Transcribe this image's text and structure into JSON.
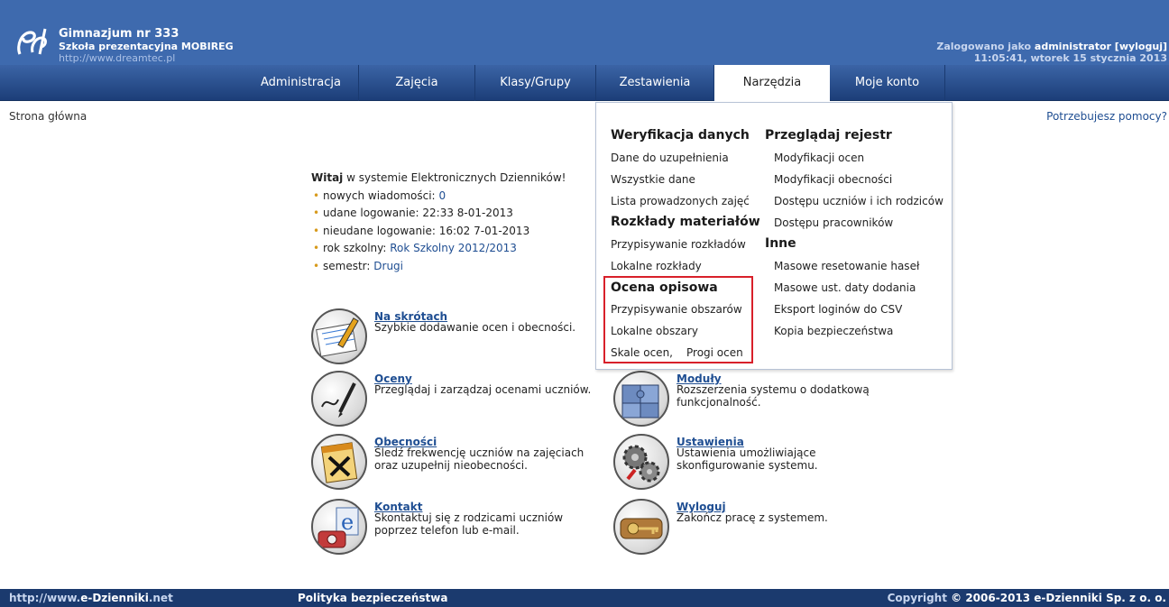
{
  "header": {
    "school_name": "Gimnazjum nr 333",
    "school_subtitle": "Szkoła prezentacyjna MOBIREG",
    "school_url": "http://www.dreamtec.pl",
    "logged_as_prefix": "Zalogowano jako",
    "user": "administrator",
    "logout": "[wyloguj]",
    "datetime": "11:05:41, wtorek 15 stycznia 2013"
  },
  "nav": {
    "tabs": [
      "Administracja",
      "Zajęcia",
      "Klasy/Grupy",
      "Zestawienia",
      "Narzędzia",
      "Moje konto"
    ],
    "active": "Narzędzia"
  },
  "breadcrumb": "Strona główna",
  "help_link": "Potrzebujesz pomocy?",
  "welcome": {
    "title_bold": "Witaj",
    "title_rest": " w systemie Elektronicznych Dzienników!",
    "items": [
      {
        "label": "nowych wiadomości:",
        "value": "0"
      },
      {
        "label": "udane logowanie:",
        "value": "22:33 8-01-2013"
      },
      {
        "label": "nieudane logowanie:",
        "value": "16:02 7-01-2013"
      },
      {
        "label": "rok szkolny:",
        "value": "Rok Szkolny 2012/2013"
      },
      {
        "label": "semestr:",
        "value": "Drugi"
      }
    ]
  },
  "shortcuts": [
    {
      "title": "Na skrótach",
      "desc": "Szybkie dodawanie ocen i obecności."
    },
    {
      "title": "Oceny",
      "desc": "Przeglądaj i zarządzaj ocenami uczniów."
    },
    {
      "title": "Obecności",
      "desc": "Śledź frekwencję uczniów na zajęciach oraz uzupełnij nieobecności."
    },
    {
      "title": "Kontakt",
      "desc": "Skontaktuj się z rodzicami uczniów poprzez telefon lub e-mail."
    },
    {
      "title": "Moduły",
      "desc": "Rozszerzenia systemu o dodatkową funkcjonalność."
    },
    {
      "title": "Ustawienia",
      "desc": "Ustawienia umożliwiające skonfigurowanie systemu."
    },
    {
      "title": "Wyloguj",
      "desc": "Zakończ pracę z systemem."
    }
  ],
  "menu": {
    "left": {
      "h1": "Weryfikacja danych",
      "h1_items": [
        "Dane do uzupełnienia",
        "Wszystkie dane",
        "Lista prowadzonych zajęć"
      ],
      "h2": "Rozkłady materiałów",
      "h2_items": [
        "Przypisywanie rozkładów",
        "Lokalne rozkłady"
      ],
      "h3": "Ocena opisowa",
      "h3_items": [
        "Przypisywanie obszarów",
        "Lokalne obszary",
        "Skale ocen,",
        "Progi ocen"
      ]
    },
    "right": {
      "h1": "Przeglądaj rejestr",
      "h1_items": [
        "Modyfikacji ocen",
        "Modyfikacji obecności",
        "Dostępu uczniów i ich rodziców",
        "Dostępu pracowników"
      ],
      "h2": "Inne",
      "h2_items": [
        "Masowe resetowanie haseł",
        "Masowe ust. daty dodania",
        "Eksport loginów do CSV",
        "Kopia bezpieczeństwa"
      ]
    }
  },
  "footer": {
    "site_prefix": "http://www.",
    "site_bold": "e-Dzienniki",
    "site_suffix": ".net",
    "policy": "Polityka bezpieczeństwa",
    "copyright_prefix": "Copyright",
    "copyright_main": "© 2006-2013 e-Dzienniki Sp. z o. o."
  }
}
